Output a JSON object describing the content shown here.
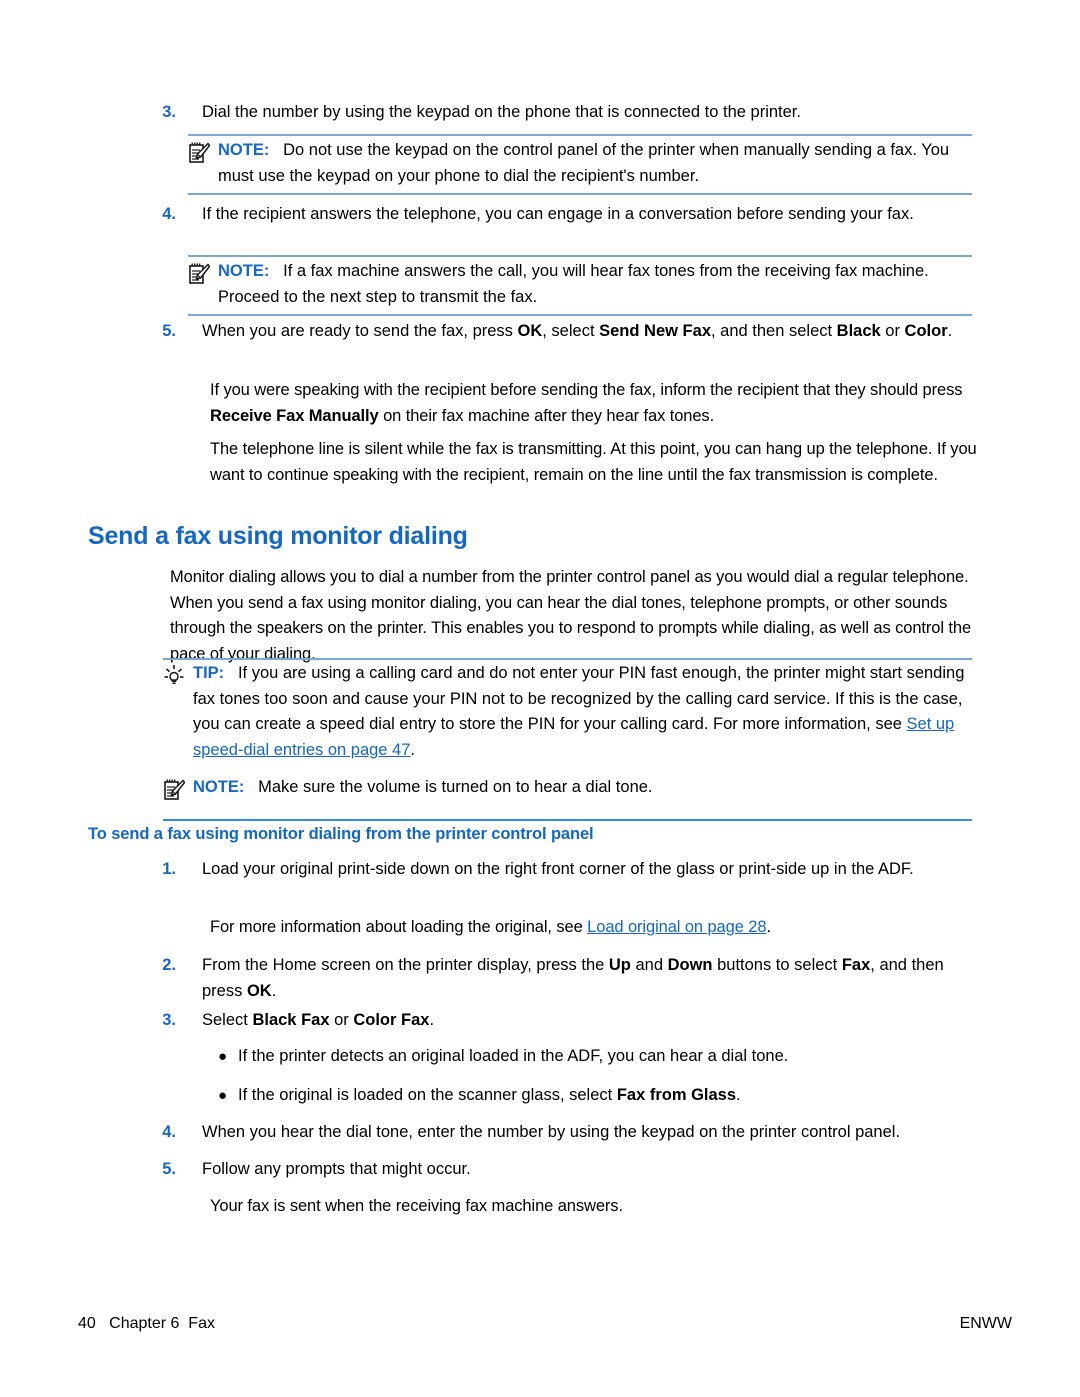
{
  "page": {
    "number": "40",
    "chapter": "Chapter 6",
    "section": "Fax",
    "locale_code": "ENWW",
    "accent_blue": "#1267c8",
    "rule_blue": "#7ba7d7",
    "rule_blue_bright": "#2e90d9"
  },
  "steps_manual_fax": [
    {
      "num": "3.",
      "text": "Dial the number by using the keypad on the phone that is connected to the printer."
    },
    {
      "num": "4.",
      "text": "If the recipient answers the telephone, you can engage in a conversation before sending your fax."
    }
  ],
  "note_keypad": {
    "icon": "note-pad-pencil-icon",
    "label": "NOTE:",
    "text": "Do not use the keypad on the control panel of the printer when manually sending a fax. You must use the keypad on your phone to dial the recipient's number."
  },
  "note_fax_machine": {
    "icon": "note-pad-pencil-icon",
    "label": "NOTE:",
    "text": "If a fax machine answers the call, you will hear fax tones from the receiving fax machine. Proceed to the next step to transmit the fax."
  },
  "step5": {
    "num": "5.",
    "seg1": "When you are ready to send the fax, press ",
    "bold1": "OK",
    "seg2": ", select ",
    "bold2": "Send New Fax",
    "seg3": ", and then select ",
    "bold3": "Black",
    "seg4": " or ",
    "bold4": "Color",
    "seg5": "."
  },
  "step5_para1": {
    "seg1": "If you were speaking with the recipient before sending the fax, inform the recipient that they should press ",
    "bold1": "Receive Fax Manually",
    "seg2": " on their fax machine after they hear fax tones."
  },
  "step5_para2": {
    "text": "The telephone line is silent while the fax is transmitting. At this point, you can hang up the telephone. If you want to continue speaking with the recipient, remain on the line until the fax transmission is complete."
  },
  "heading_main": "Send a fax using monitor dialing",
  "intro_para": "Monitor dialing allows you to dial a number from the printer control panel as you would dial a regular telephone. When you send a fax using monitor dialing, you can hear the dial tones, telephone prompts, or other sounds through the speakers on the printer. This enables you to respond to prompts while dialing, as well as control the pace of your dialing.",
  "tip_calling_card": {
    "icon": "lightbulb-icon",
    "label": "TIP:",
    "seg1": "If you are using a calling card and do not enter your PIN fast enough, the printer might start sending fax tones too soon and cause your PIN not to be recognized by the calling card service. If this is the case, you can create a speed dial entry to store the PIN for your calling card. For more information, see ",
    "link": "Set up speed-dial entries on page 47",
    "seg2": "."
  },
  "note_volume": {
    "icon": "note-pad-pencil-icon",
    "label": "NOTE:",
    "text": "Make sure the volume is turned on to hear a dial tone."
  },
  "heading_sub": "To send a fax using monitor dialing from the printer control panel",
  "steps_monitor": {
    "s1": {
      "num": "1.",
      "text": "Load your original print-side down on the right front corner of the glass or print-side up in the ADF."
    },
    "s1_note": {
      "seg1": "For more information about loading the original, see ",
      "link": "Load original on page 28",
      "seg2": "."
    },
    "s2": {
      "num": "2.",
      "seg1": "From the Home screen on the printer display, press the ",
      "bold1": "Up",
      "seg2": " and ",
      "bold2": "Down",
      "seg3": " buttons to select ",
      "bold3": "Fax",
      "seg4": ", and then press ",
      "bold4": "OK",
      "seg5": "."
    },
    "s3": {
      "num": "3.",
      "seg1": "Select ",
      "bold1": "Black Fax",
      "seg2": " or ",
      "bold2": "Color Fax",
      "seg3": "."
    },
    "bullets": [
      {
        "marker": "●",
        "text": "If the printer detects an original loaded in the ADF, you can hear a dial tone."
      },
      {
        "marker": "●",
        "seg1": "If the original is loaded on the scanner glass, select ",
        "bold1": "Fax from Glass",
        "seg2": "."
      }
    ],
    "s4": {
      "num": "4.",
      "text": "When you hear the dial tone, enter the number by using the keypad on the printer control panel."
    },
    "s5": {
      "num": "5.",
      "text": "Follow any prompts that might occur."
    },
    "s5_note": {
      "text": "Your fax is sent when the receiving fax machine answers."
    }
  }
}
